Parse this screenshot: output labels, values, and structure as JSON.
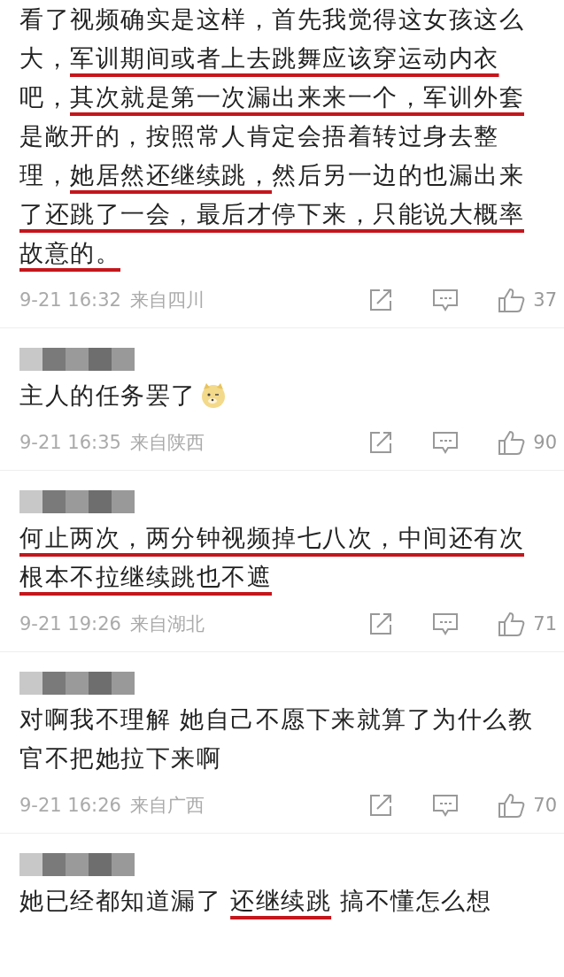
{
  "comments": [
    {
      "name_redacted": false,
      "trailing_emoji": false,
      "lines": [
        [
          {
            "text": "看了视频确实是这样，首先我觉得这女孩这么",
            "underlined": false
          }
        ],
        [
          {
            "text": "大，",
            "underlined": false
          },
          {
            "text": "军训期间或者上去跳舞应该穿运动内衣",
            "underlined": true
          }
        ],
        [
          {
            "text": "吧，",
            "underlined": false
          },
          {
            "text": "其次就是第一次漏出来来一个，军训外套",
            "underlined": true
          }
        ],
        [
          {
            "text": "是敞开的，按照常人肯定会捂着转过身去整",
            "underlined": false
          }
        ],
        [
          {
            "text": "理，",
            "underlined": false
          },
          {
            "text": "她居然还继续跳，",
            "underlined": true
          },
          {
            "text": "然后另一边的也漏出来",
            "underlined": false
          }
        ],
        [
          {
            "text": "了还跳了一会，最后才停下来，只能说大概率",
            "underlined": true
          }
        ],
        [
          {
            "text": "故意的。",
            "underlined": true
          }
        ]
      ],
      "time": "9-21 16:32",
      "location": "来自四川",
      "likes": "37"
    },
    {
      "name_redacted": true,
      "trailing_emoji": true,
      "lines": [
        [
          {
            "text": "主人的任务罢了",
            "underlined": false
          }
        ]
      ],
      "time": "9-21 16:35",
      "location": "来自陕西",
      "likes": "90"
    },
    {
      "name_redacted": true,
      "trailing_emoji": false,
      "lines": [
        [
          {
            "text": "何止两次，两分钟视频掉七八次，中间还有次",
            "underlined": true
          }
        ],
        [
          {
            "text": "根本不拉继续跳也不遮",
            "underlined": true
          }
        ]
      ],
      "time": "9-21 19:26",
      "location": "来自湖北",
      "likes": "71"
    },
    {
      "name_redacted": true,
      "trailing_emoji": false,
      "lines": [
        [
          {
            "text": "对啊我不理解 她自己不愿下来就算了为什么教",
            "underlined": false
          }
        ],
        [
          {
            "text": "官不把她拉下来啊",
            "underlined": false
          }
        ]
      ],
      "time": "9-21 16:26",
      "location": "来自广西",
      "likes": "70"
    },
    {
      "name_redacted": true,
      "trailing_emoji": false,
      "lines": [
        [
          {
            "text": "她已经都知道漏了 ",
            "underlined": false
          },
          {
            "text": "还继续跳",
            "underlined": true
          },
          {
            "text": " 搞不懂怎么想",
            "underlined": false
          }
        ]
      ]
    }
  ]
}
